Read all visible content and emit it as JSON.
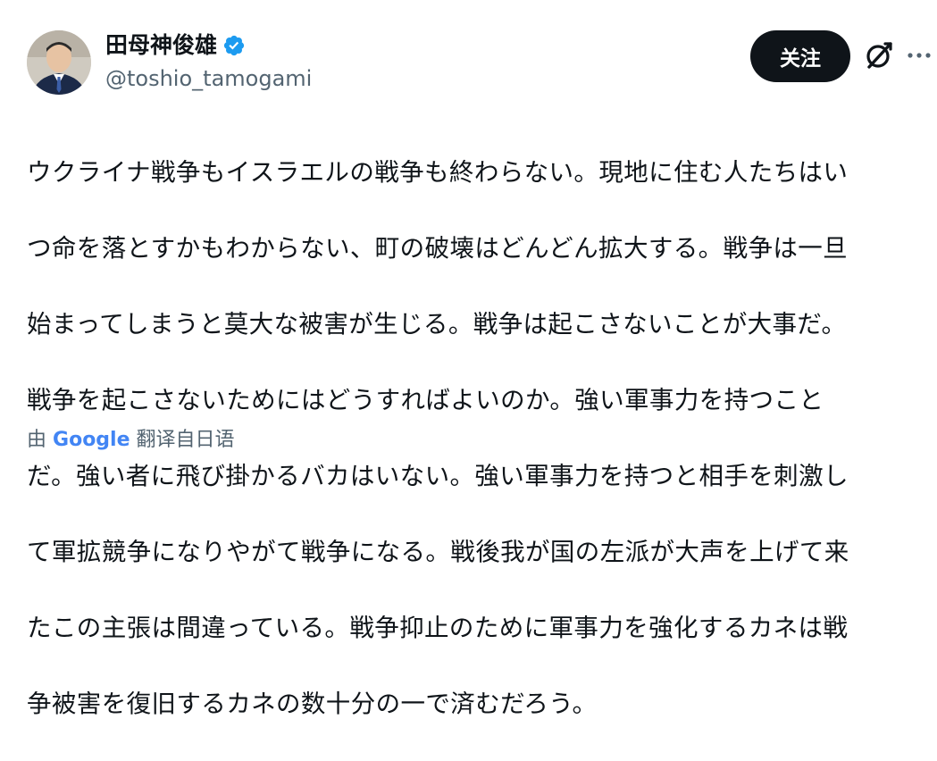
{
  "author": {
    "name": "田母神俊雄",
    "handle": "@toshio_tamogami",
    "verified_color": "#1d9bf0",
    "avatar_icon": "profile-photo"
  },
  "actions": {
    "follow_label": "关注",
    "grok_icon": "grok-icon",
    "more_icon": "more-icon"
  },
  "tweet": {
    "lines": [
      "ウクライナ戦争もイスラエルの戦争も終わらない。現地に住む人たちはい",
      "つ命を落とすかもわからない、町の破壊はどんどん拡大する。戦争は一旦",
      "始まってしまうと莫大な被害が生じる。戦争は起こさないことが大事だ。",
      "戦争を起こさないためにはどうすればよいのか。強い軍事力を持つこと",
      "だ。強い者に飛び掛かるバカはいない。強い軍事力を持つと相手を刺激し",
      "て軍拡競争になりやがて戦争になる。戦後我が国の左派が大声を上げて来",
      "たこの主張は間違っている。戦争抑止のために軍事力を強化するカネは戦",
      "争被害を復旧するカネの数十分の一で済むだろう。"
    ]
  },
  "translation": {
    "prefix": "由",
    "provider": "Google",
    "label": "翻译自日语"
  },
  "colors": {
    "text": "#0f1419",
    "secondary": "#536471",
    "button_bg": "#0f1419",
    "verified": "#1d9bf0"
  }
}
